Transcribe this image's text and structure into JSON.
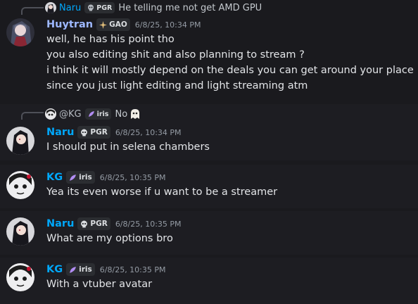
{
  "colors": {
    "naru": "#00a8fc",
    "huytran": "#9eb8ff",
    "kg": "#00a8fc",
    "background": "#1a1a1e"
  },
  "messages": [
    {
      "reply": {
        "author": "Naru",
        "tag": "PGR",
        "text": "He telling me not get AMD GPU"
      },
      "author": "Huytran",
      "tag": "GAO",
      "timestamp": "6/8/25, 10:34 PM",
      "lines": [
        "well, he has his point tho",
        "you also editing shit and also planning to stream ?",
        "i think it will mostly depend on the deals you can get around your place",
        "since you just light editing and light streaming atm"
      ]
    },
    {
      "reply": {
        "author": "@KG",
        "tag": "iris",
        "text": "No"
      },
      "author": "Naru",
      "tag": "PGR",
      "timestamp": "6/8/25, 10:34 PM",
      "lines": [
        "I should put in selena chambers"
      ]
    },
    {
      "author": "KG",
      "tag": "iris",
      "timestamp": "6/8/25, 10:35 PM",
      "lines": [
        "Yea its even worse if u want to be a streamer"
      ]
    },
    {
      "author": "Naru",
      "tag": "PGR",
      "timestamp": "6/8/25, 10:35 PM",
      "lines": [
        "What are my options bro"
      ]
    },
    {
      "author": "KG",
      "tag": "iris",
      "timestamp": "6/8/25, 10:35 PM",
      "lines": [
        "With a vtuber avatar"
      ]
    }
  ]
}
